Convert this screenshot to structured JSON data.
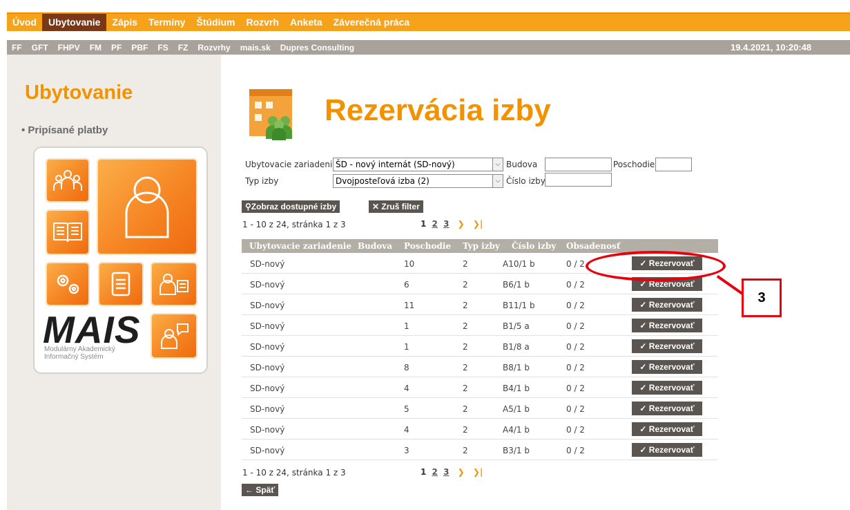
{
  "topnav": [
    "Úvod",
    "Ubytovanie",
    "Zápis",
    "Termíny",
    "Štúdium",
    "Rozvrh",
    "Anketa",
    "Záverečná práca"
  ],
  "subnav": [
    "FF",
    "GFT",
    "FHPV",
    "FM",
    "PF",
    "PBF",
    "FS",
    "FZ",
    "Rozvrhy",
    "mais.sk",
    "Dupres Consulting"
  ],
  "datetime": "19.4.2021, 10:20:48",
  "sidebar": {
    "title": "Ubytovanie",
    "link": "• Pripísané platby",
    "logo_text": "MAIS",
    "logo_sub1": "Modulárny Akademický",
    "logo_sub2": "Informačný Systém"
  },
  "page": {
    "title": "Rezervácia izby"
  },
  "filters": {
    "ubytovacie_label": "Ubytovacie zariadenie",
    "ubytovacie_value": "ŠD - nový internát (SD-nový)",
    "budova_label": "Budova",
    "budova_value": "",
    "poschodie_label": "Poschodie",
    "poschodie_value": "",
    "typ_label": "Typ izby",
    "typ_value": "Dvojposteľová izba (2)",
    "cislo_label": "Číslo izby",
    "cislo_value": ""
  },
  "buttons": {
    "show": "Zobraz dostupné izby",
    "clear": "Zruš filter",
    "back": "Späť",
    "reserve": "Rezervovať"
  },
  "paging": {
    "text": "1 - 10 z 24, stránka 1 z 3",
    "current": "1",
    "pages": [
      "2",
      "3"
    ]
  },
  "table": {
    "headers": [
      "Ubytovacie zariadenie",
      "Budova",
      "Poschodie",
      "Typ izby",
      "Číslo izby",
      "Obsadenosť"
    ],
    "rows": [
      [
        "SD-nový",
        "",
        "10",
        "2",
        "A10/1 b",
        "0 / 2"
      ],
      [
        "SD-nový",
        "",
        "6",
        "2",
        "B6/1 b",
        "0 / 2"
      ],
      [
        "SD-nový",
        "",
        "11",
        "2",
        "B11/1 b",
        "0 / 2"
      ],
      [
        "SD-nový",
        "",
        "1",
        "2",
        "B1/5 a",
        "0 / 2"
      ],
      [
        "SD-nový",
        "",
        "1",
        "2",
        "B1/8 a",
        "0 / 2"
      ],
      [
        "SD-nový",
        "",
        "8",
        "2",
        "B8/1 b",
        "0 / 2"
      ],
      [
        "SD-nový",
        "",
        "4",
        "2",
        "B4/1 b",
        "0 / 2"
      ],
      [
        "SD-nový",
        "",
        "5",
        "2",
        "A5/1 b",
        "0 / 2"
      ],
      [
        "SD-nový",
        "",
        "4",
        "2",
        "A4/1 b",
        "0 / 2"
      ],
      [
        "SD-nový",
        "",
        "3",
        "2",
        "B3/1 b",
        "0 / 2"
      ]
    ]
  },
  "annotation": {
    "label": "3"
  },
  "colors": {
    "orange": "#f39200",
    "navbar": "#f7a21b",
    "active_tab": "#7a3816",
    "button": "#5a5550",
    "annotation": "#e8000b"
  }
}
